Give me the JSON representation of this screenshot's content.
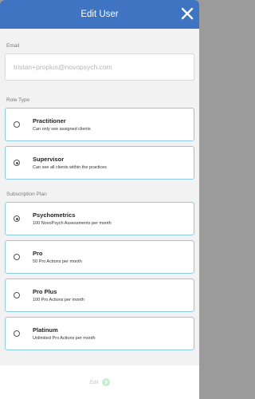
{
  "header": {
    "title": "Edit User"
  },
  "email": {
    "label": "Email",
    "value": "tristan+proplus@novopsych.com"
  },
  "role": {
    "label": "Role Type",
    "options": [
      {
        "title": "Practitioner",
        "desc": "Can only see assigned clients",
        "selected": false
      },
      {
        "title": "Supervisor",
        "desc": "Can see all clients within the practices",
        "selected": true
      }
    ]
  },
  "plan": {
    "label": "Subscription Plan",
    "options": [
      {
        "title": "Psychometrics",
        "desc": "100 NovoPsych Assessments per month",
        "selected": true
      },
      {
        "title": "Pro",
        "desc": "50 Pro Actions per month",
        "selected": false
      },
      {
        "title": "Pro Plus",
        "desc": "100 Pro Actions per month",
        "selected": false
      },
      {
        "title": "Platinum",
        "desc": "Unlimited Pro Actions per month",
        "selected": false
      }
    ]
  },
  "footer": {
    "edit_label": "Edit"
  },
  "colors": {
    "header": "#3e74c1",
    "option_border": "#8cc8e8",
    "edit_chevron": "#c8ecd0"
  },
  "icons": {
    "close": "close-icon",
    "edit": "chevron-right-icon"
  }
}
